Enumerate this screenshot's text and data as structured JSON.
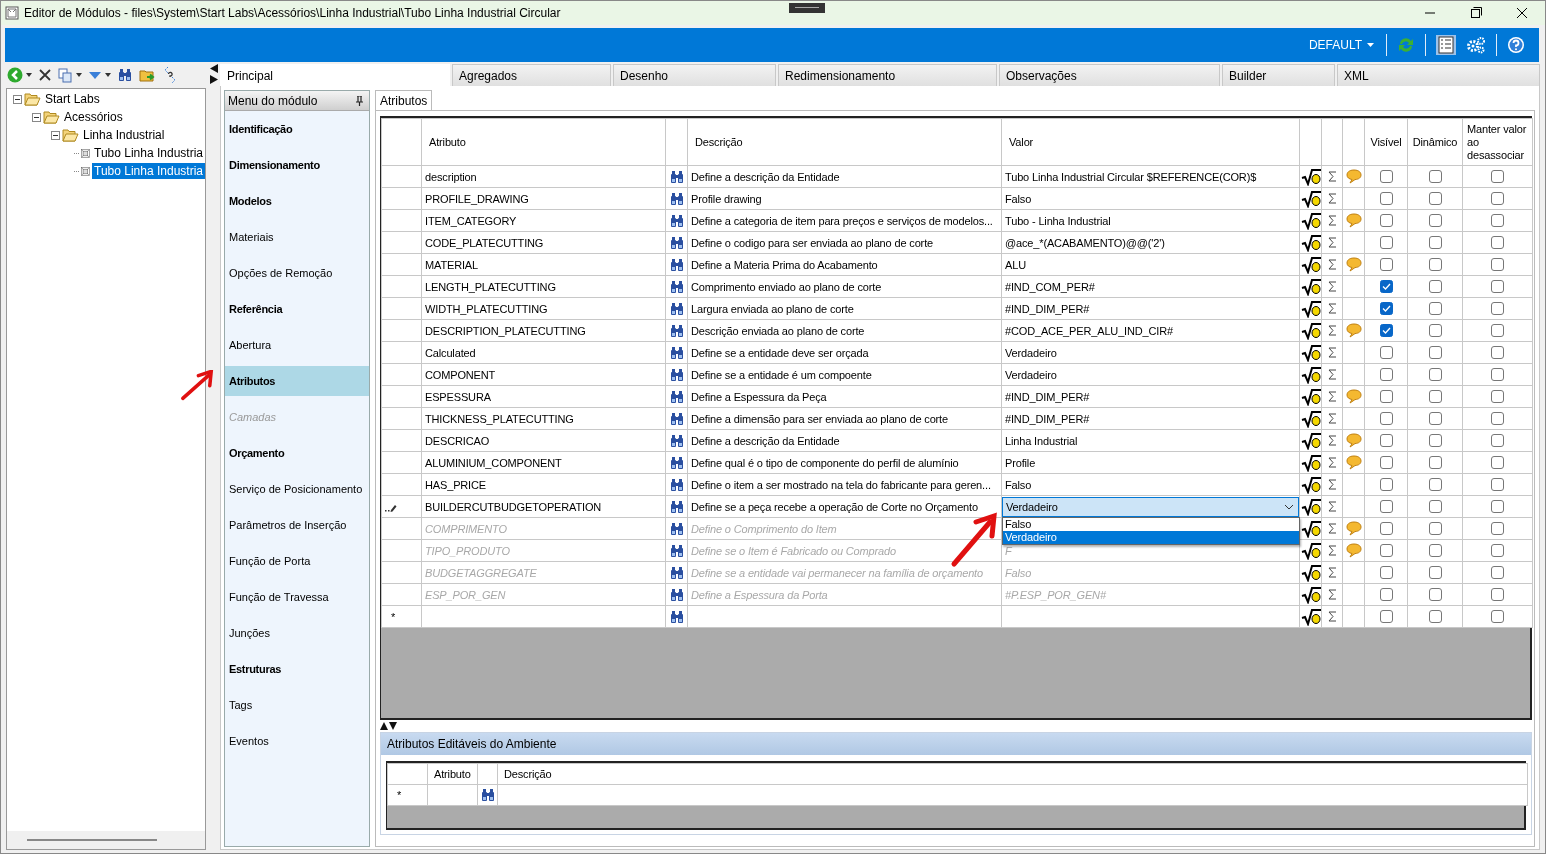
{
  "window": {
    "title": "Editor de Módulos - files\\System\\Start Labs\\Acessórios\\Linha Industrial\\Tubo Linha Industrial Circular"
  },
  "app_bar": {
    "profile": "DEFAULT"
  },
  "tree": [
    {
      "label": "Start Labs",
      "expanded": true,
      "selected": false,
      "children": [
        {
          "label": "Acessórios",
          "expanded": true,
          "selected": false,
          "children": [
            {
              "label": "Linha Industrial",
              "expanded": true,
              "selected": false,
              "children": [
                {
                  "label": "Tubo Linha Industria",
                  "selected": false
                },
                {
                  "label": "Tubo Linha Industria",
                  "selected": true
                }
              ]
            }
          ]
        }
      ]
    }
  ],
  "tabs": [
    {
      "label": "Principal",
      "selected": true
    },
    {
      "label": "Agregados",
      "selected": false
    },
    {
      "label": "Desenho",
      "selected": false
    },
    {
      "label": "Redimensionamento",
      "selected": false
    },
    {
      "label": "Observações",
      "selected": false
    },
    {
      "label": "Builder",
      "selected": false
    },
    {
      "label": "XML",
      "selected": false
    }
  ],
  "module_menu": {
    "title": "Menu do módulo",
    "items": [
      {
        "label": "Identificação",
        "kind": "section",
        "selected": false,
        "disabled": false,
        "arrow": false
      },
      {
        "label": "Dimensionamento",
        "kind": "section",
        "selected": false,
        "disabled": false,
        "arrow": false
      },
      {
        "label": "Modelos",
        "kind": "section",
        "selected": false,
        "disabled": false,
        "arrow": false
      },
      {
        "label": "Materiais",
        "kind": "item",
        "selected": false,
        "disabled": false,
        "arrow": false
      },
      {
        "label": "Opções de Remoção",
        "kind": "item",
        "selected": false,
        "disabled": false,
        "arrow": false
      },
      {
        "label": "Referência",
        "kind": "section",
        "selected": false,
        "disabled": false,
        "arrow": false
      },
      {
        "label": "Abertura",
        "kind": "item",
        "selected": false,
        "disabled": false,
        "arrow": false
      },
      {
        "label": "Atributos",
        "kind": "section",
        "selected": true,
        "disabled": false,
        "arrow": true
      },
      {
        "label": "Camadas",
        "kind": "item",
        "selected": false,
        "disabled": true,
        "arrow": false
      },
      {
        "label": "Orçamento",
        "kind": "section",
        "selected": false,
        "disabled": false,
        "arrow": false
      },
      {
        "label": "Serviço de Posicionamento",
        "kind": "item",
        "selected": false,
        "disabled": false,
        "arrow": false
      },
      {
        "label": "Parâmetros de Inserção",
        "kind": "item",
        "selected": false,
        "disabled": false,
        "arrow": false
      },
      {
        "label": "Função de Porta",
        "kind": "item",
        "selected": false,
        "disabled": false,
        "arrow": false
      },
      {
        "label": "Função de Travessa",
        "kind": "item",
        "selected": false,
        "disabled": false,
        "arrow": false
      },
      {
        "label": "Junções",
        "kind": "item",
        "selected": false,
        "disabled": false,
        "arrow": false
      },
      {
        "label": "Estruturas",
        "kind": "section",
        "selected": false,
        "disabled": false,
        "arrow": false
      },
      {
        "label": "Tags",
        "kind": "item",
        "selected": false,
        "disabled": false,
        "arrow": false
      },
      {
        "label": "Eventos",
        "kind": "item",
        "selected": false,
        "disabled": false,
        "arrow": false
      }
    ]
  },
  "sub_tabs": [
    {
      "label": "Atributos",
      "selected": true
    }
  ],
  "attributes_table": {
    "columns": {
      "attribute": "Atributo",
      "description": "Descrição",
      "value": "Valor",
      "visible": "Visível",
      "dynamic": "Dinâmico",
      "keep": "Manter valor ao desassociar"
    },
    "rows": [
      {
        "kind": "data",
        "attribute": "description",
        "description": "Define a descrição da Entidade",
        "value": "Tubo Linha Industrial Circular $REFERENCE(COR)$",
        "comment": true,
        "visible": false,
        "dynamic": false,
        "keep": false,
        "inherited": false
      },
      {
        "kind": "data",
        "attribute": "PROFILE_DRAWING",
        "description": "Profile drawing",
        "value": "Falso",
        "comment": false,
        "visible": false,
        "dynamic": false,
        "keep": false,
        "inherited": false
      },
      {
        "kind": "data",
        "attribute": "ITEM_CATEGORY",
        "description": "Define a categoria de item para preços e serviços de modelos...",
        "value": "Tubo - Linha Industrial",
        "comment": true,
        "visible": false,
        "dynamic": false,
        "keep": false,
        "inherited": false
      },
      {
        "kind": "data",
        "attribute": "CODE_PLATECUTTING",
        "description": "Define o codigo para ser enviada ao plano de corte",
        "value": "@ace_*(ACABAMENTO)@@('2')",
        "comment": false,
        "visible": false,
        "dynamic": false,
        "keep": false,
        "inherited": false
      },
      {
        "kind": "data",
        "attribute": "MATERIAL",
        "description": "Define a Materia Prima do Acabamento",
        "value": "ALU",
        "comment": true,
        "visible": false,
        "dynamic": false,
        "keep": false,
        "inherited": false
      },
      {
        "kind": "data",
        "attribute": "LENGTH_PLATECUTTING",
        "description": "Comprimento enviado ao plano de corte",
        "value": "#IND_COM_PER#",
        "comment": false,
        "visible": true,
        "dynamic": false,
        "keep": false,
        "inherited": false
      },
      {
        "kind": "data",
        "attribute": "WIDTH_PLATECUTTING",
        "description": "Largura enviada ao plano de corte",
        "value": "#IND_DIM_PER#",
        "comment": false,
        "visible": true,
        "dynamic": false,
        "keep": false,
        "inherited": false
      },
      {
        "kind": "data",
        "attribute": "DESCRIPTION_PLATECUTTING",
        "description": "Descrição enviada ao plano de corte",
        "value": "#COD_ACE_PER_ALU_IND_CIR#",
        "comment": true,
        "visible": true,
        "dynamic": false,
        "keep": false,
        "inherited": false
      },
      {
        "kind": "data",
        "attribute": "Calculated",
        "description": "Define se a entidade deve ser orçada",
        "value": "Verdadeiro",
        "comment": false,
        "visible": false,
        "dynamic": false,
        "keep": false,
        "inherited": false
      },
      {
        "kind": "data",
        "attribute": "COMPONENT",
        "description": "Define se a entidade é um compoente",
        "value": "Verdadeiro",
        "comment": false,
        "visible": false,
        "dynamic": false,
        "keep": false,
        "inherited": false
      },
      {
        "kind": "data",
        "attribute": "ESPESSURA",
        "description": "Define a Espessura da Peça",
        "value": "#IND_DIM_PER#",
        "comment": true,
        "visible": false,
        "dynamic": false,
        "keep": false,
        "inherited": false
      },
      {
        "kind": "data",
        "attribute": "THICKNESS_PLATECUTTING",
        "description": "Define a dimensão para ser enviada ao plano de corte",
        "value": "#IND_DIM_PER#",
        "comment": false,
        "visible": false,
        "dynamic": false,
        "keep": false,
        "inherited": false
      },
      {
        "kind": "data",
        "attribute": "DESCRICAO",
        "description": "Define a descrição da Entidade",
        "value": "Linha Industrial",
        "comment": true,
        "visible": false,
        "dynamic": false,
        "keep": false,
        "inherited": false
      },
      {
        "kind": "data",
        "attribute": "ALUMINIUM_COMPONENT",
        "description": "Define qual é o tipo de componente do perfil de alumínio",
        "value": "Profile",
        "comment": true,
        "visible": false,
        "dynamic": false,
        "keep": false,
        "inherited": false
      },
      {
        "kind": "data",
        "attribute": "HAS_PRICE",
        "description": "Define o item a ser mostrado na tela do fabricante para geren...",
        "value": "Falso",
        "comment": false,
        "visible": false,
        "dynamic": false,
        "keep": false,
        "inherited": false
      },
      {
        "kind": "editing",
        "attribute": "BUILDERCUTBUDGETOPERATION",
        "description": "Define se a peça recebe a operação de Corte no Orçamento",
        "value": "Verdadeiro",
        "options": [
          {
            "label": "Falso",
            "selected": false
          },
          {
            "label": "Verdadeiro",
            "selected": true
          }
        ],
        "arrow": true,
        "comment": false,
        "visible": false,
        "dynamic": false,
        "keep": false,
        "inherited": false
      },
      {
        "kind": "data",
        "attribute": "COMPRIMENTO",
        "description": "Define o Comprimento do Item",
        "comment": true,
        "visible": false,
        "dynamic": false,
        "keep": false,
        "inherited": true
      },
      {
        "kind": "data",
        "attribute": "TIPO_PRODUTO",
        "description": "Define se o Item é Fabricado ou Comprado",
        "value": "F",
        "comment": true,
        "visible": false,
        "dynamic": false,
        "keep": false,
        "inherited": true
      },
      {
        "kind": "data",
        "attribute": "BUDGETAGGREGATE",
        "description": "Define se a entidade vai permanecer na família de orçamento",
        "value": "Falso",
        "comment": false,
        "visible": false,
        "dynamic": false,
        "keep": false,
        "inherited": true
      },
      {
        "kind": "data",
        "attribute": "ESP_POR_GEN",
        "description": "Define a Espessura da Porta",
        "value": "#P.ESP_POR_GEN#",
        "comment": false,
        "visible": false,
        "dynamic": false,
        "keep": false,
        "inherited": true
      },
      {
        "kind": "new",
        "marker": "*",
        "visible": false,
        "dynamic": false,
        "keep": false
      }
    ]
  },
  "environment_attributes": {
    "title": "Atributos Editáveis do Ambiente",
    "columns": {
      "attribute": "Atributo",
      "description": "Descrição"
    },
    "rows": [
      {
        "kind": "new",
        "marker": "*"
      }
    ]
  }
}
